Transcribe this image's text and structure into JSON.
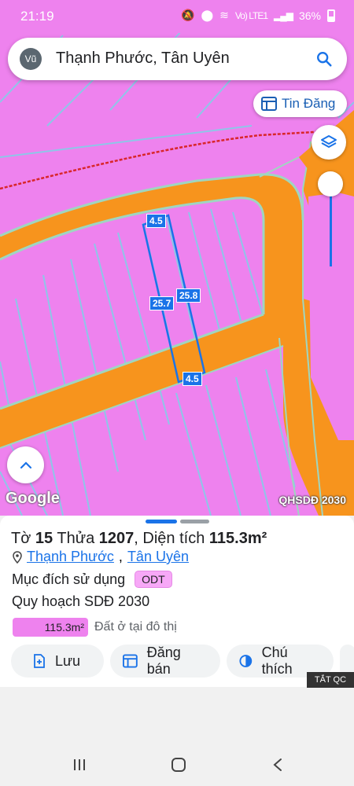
{
  "status_bar": {
    "time": "21:19",
    "battery": "36%",
    "network": "Vo) LTE1"
  },
  "search": {
    "avatar_text": "Vũ",
    "query": "Thạnh Phước, Tân Uyên"
  },
  "map": {
    "tin_dang_label": "Tin Đăng",
    "google_logo": "Google",
    "layer_label": "QHSDĐ 2030",
    "dimensions": {
      "top": "4.5",
      "left": "25.7",
      "right": "25.8",
      "bottom": "4.5"
    }
  },
  "sheet": {
    "title_prefix": "Tờ",
    "sheet_no": "15",
    "parcel_word": "Thửa",
    "parcel_no": "1207",
    "area_word": ", Diện tích",
    "area_value": "115.3m²",
    "ward": "Thạnh Phước",
    "separator": ",",
    "district": "Tân Uyên",
    "purpose_label": "Mục đích sử dụng",
    "purpose_code": "ODT",
    "plan_label": "Quy hoạch SDĐ 2030",
    "plan_area": "115.3m²",
    "plan_desc": "Đất ở tại đô thị",
    "actions": [
      {
        "label": "Lưu",
        "icon": "save-icon"
      },
      {
        "label": "Đăng bán",
        "icon": "listing-icon"
      },
      {
        "label": "Chú thích",
        "icon": "legend-icon"
      }
    ],
    "ad_label": "TẮT QC"
  },
  "colors": {
    "pink": "#ee82ee",
    "road": "#f7941d",
    "accent": "#1a73e8"
  }
}
